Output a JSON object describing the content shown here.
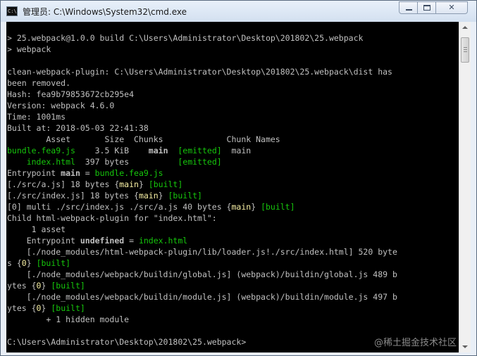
{
  "window": {
    "title": "管理员: C:\\Windows\\System32\\cmd.exe",
    "icon": "cmd-icon",
    "controls": {
      "minimize": "minimize-icon",
      "maximize": "maximize-icon",
      "close": "close-icon"
    }
  },
  "console": {
    "lines": [
      [
        {
          "t": "> 25.webpack@1.0.0 build C:\\Users\\Administrator\\Desktop\\201802\\25.webpack"
        }
      ],
      [
        {
          "t": "> webpack"
        }
      ],
      [
        {
          "t": ""
        }
      ],
      [
        {
          "t": "clean-webpack-plugin: C:\\Users\\Administrator\\Desktop\\201802\\25.webpack\\dist has"
        }
      ],
      [
        {
          "t": "been removed."
        }
      ],
      [
        {
          "t": "Hash: fea9b79853672cb295e4"
        }
      ],
      [
        {
          "t": "Version: webpack 4.6.0"
        }
      ],
      [
        {
          "t": "Time: 1001ms"
        }
      ],
      [
        {
          "t": "Built at: 2018-05-03 22:41:38"
        }
      ],
      [
        {
          "t": "        Asset       Size  Chunks             Chunk Names"
        }
      ],
      [
        {
          "t": "bundle.fea9.js",
          "c": "g"
        },
        {
          "t": "    3.5 KiB    "
        },
        {
          "t": "main",
          "c": "b"
        },
        {
          "t": "  "
        },
        {
          "t": "[emitted]",
          "c": "g"
        },
        {
          "t": "  main"
        }
      ],
      [
        {
          "t": "    "
        },
        {
          "t": "index.html",
          "c": "g"
        },
        {
          "t": "  397 bytes          "
        },
        {
          "t": "[emitted]",
          "c": "g"
        }
      ],
      [
        {
          "t": "Entrypoint "
        },
        {
          "t": "main",
          "c": "b"
        },
        {
          "t": " = "
        },
        {
          "t": "bundle.fea9.js",
          "c": "g"
        }
      ],
      [
        {
          "t": "[./src/a.js] 18 bytes {"
        },
        {
          "t": "main",
          "c": "y"
        },
        {
          "t": "} "
        },
        {
          "t": "[built]",
          "c": "g"
        }
      ],
      [
        {
          "t": "[./src/index.js] 18 bytes {"
        },
        {
          "t": "main",
          "c": "y"
        },
        {
          "t": "} "
        },
        {
          "t": "[built]",
          "c": "g"
        }
      ],
      [
        {
          "t": "[0] multi ./src/index.js ./src/a.js 40 bytes {"
        },
        {
          "t": "main",
          "c": "y"
        },
        {
          "t": "} "
        },
        {
          "t": "[built]",
          "c": "g"
        }
      ],
      [
        {
          "t": "Child html-webpack-plugin for \"index.html\":"
        }
      ],
      [
        {
          "t": "     1 asset"
        }
      ],
      [
        {
          "t": "    Entrypoint "
        },
        {
          "t": "undefined",
          "c": "b"
        },
        {
          "t": " = "
        },
        {
          "t": "index.html",
          "c": "g"
        }
      ],
      [
        {
          "t": "    [./node_modules/html-webpack-plugin/lib/loader.js!./src/index.html] 520 byte"
        }
      ],
      [
        {
          "t": "s {"
        },
        {
          "t": "0",
          "c": "y"
        },
        {
          "t": "} "
        },
        {
          "t": "[built]",
          "c": "g"
        }
      ],
      [
        {
          "t": "    [./node_modules/webpack/buildin/global.js] (webpack)/buildin/global.js 489 b"
        }
      ],
      [
        {
          "t": "ytes {"
        },
        {
          "t": "0",
          "c": "y"
        },
        {
          "t": "} "
        },
        {
          "t": "[built]",
          "c": "g"
        }
      ],
      [
        {
          "t": "    [./node_modules/webpack/buildin/module.js] (webpack)/buildin/module.js 497 b"
        }
      ],
      [
        {
          "t": "ytes {"
        },
        {
          "t": "0",
          "c": "y"
        },
        {
          "t": "} "
        },
        {
          "t": "[built]",
          "c": "g"
        }
      ],
      [
        {
          "t": "        + 1 hidden module"
        }
      ],
      [
        {
          "t": ""
        }
      ],
      [
        {
          "t": "C:\\Users\\Administrator\\Desktop\\201802\\25.webpack>"
        }
      ]
    ]
  },
  "scrollbar": {
    "position": 0.0
  },
  "watermark": "@稀土掘金技术社区",
  "colors": {
    "console_bg": "#000000",
    "console_text": "#c0c0c0",
    "green": "#16c60c",
    "yellow": "#f9f1a5"
  }
}
